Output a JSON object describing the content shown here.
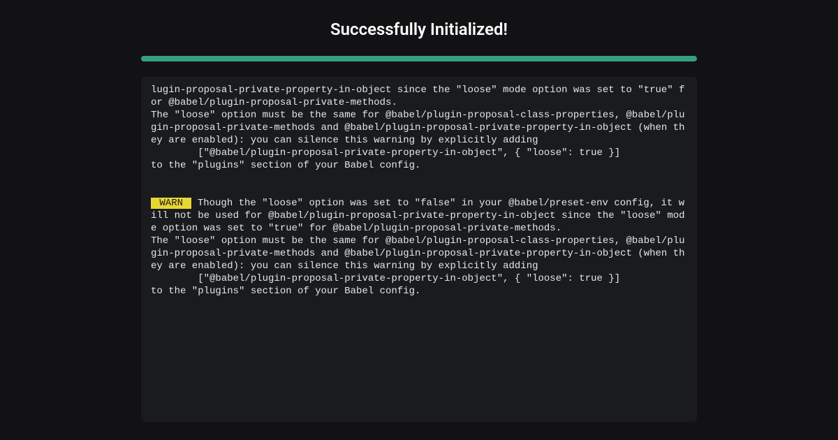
{
  "title": "Successfully Initialized!",
  "progress": {
    "percent": 100,
    "color": "#389e82"
  },
  "warn_label": " WARN ",
  "log_block_1": "lugin-proposal-private-property-in-object since the \"loose\" mode option was set to \"true\" for @babel/plugin-proposal-private-methods.\nThe \"loose\" option must be the same for @babel/plugin-proposal-class-properties, @babel/plugin-proposal-private-methods and @babel/plugin-proposal-private-property-in-object (when they are enabled): you can silence this warning by explicitly adding\n        [\"@babel/plugin-proposal-private-property-in-object\", { \"loose\": true }]\nto the \"plugins\" section of your Babel config.",
  "log_block_2_after_warn": " Though the \"loose\" option was set to \"false\" in your @babel/preset-env config, it will not be used for @babel/plugin-proposal-private-property-in-object since the \"loose\" mode option was set to \"true\" for @babel/plugin-proposal-private-methods.\nThe \"loose\" option must be the same for @babel/plugin-proposal-class-properties, @babel/plugin-proposal-private-methods and @babel/plugin-proposal-private-property-in-object (when they are enabled): you can silence this warning by explicitly adding\n        [\"@babel/plugin-proposal-private-property-in-object\", { \"loose\": true }]\nto the \"plugins\" section of your Babel config."
}
